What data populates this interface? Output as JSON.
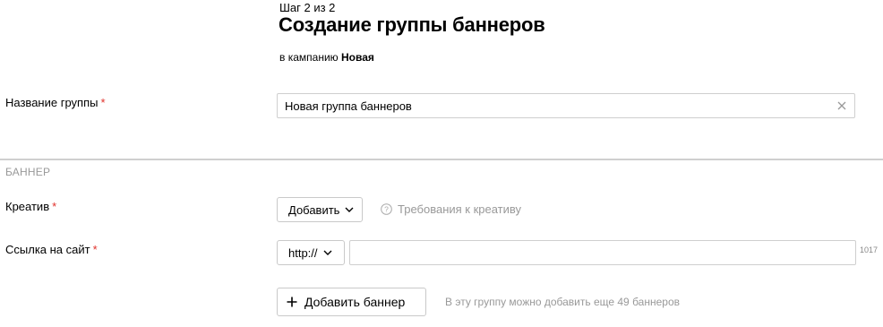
{
  "header": {
    "step": "Шаг 2 из 2",
    "title": "Создание группы баннеров",
    "campaign_prefix": "в кампанию",
    "campaign_name": "Новая"
  },
  "group_name": {
    "label": "Название группы",
    "required_mark": "*",
    "value": "Новая группа баннеров",
    "clear_icon": "close-icon"
  },
  "banner_section": {
    "title": "БАННЕР",
    "creative": {
      "label": "Креатив",
      "required_mark": "*",
      "add_button": "Добавить",
      "requirements_link": "Требования к креативу"
    },
    "site_link": {
      "label": "Ссылка на сайт",
      "required_mark": "*",
      "protocol": "http://",
      "value": "",
      "char_counter": "1017"
    },
    "add_banner_button": "Добавить баннер",
    "remaining_note": "В эту группу можно добавить еще 49 баннеров"
  },
  "colors": {
    "required": "#e0302a",
    "muted": "#999999",
    "border": "#cfcfcf"
  }
}
